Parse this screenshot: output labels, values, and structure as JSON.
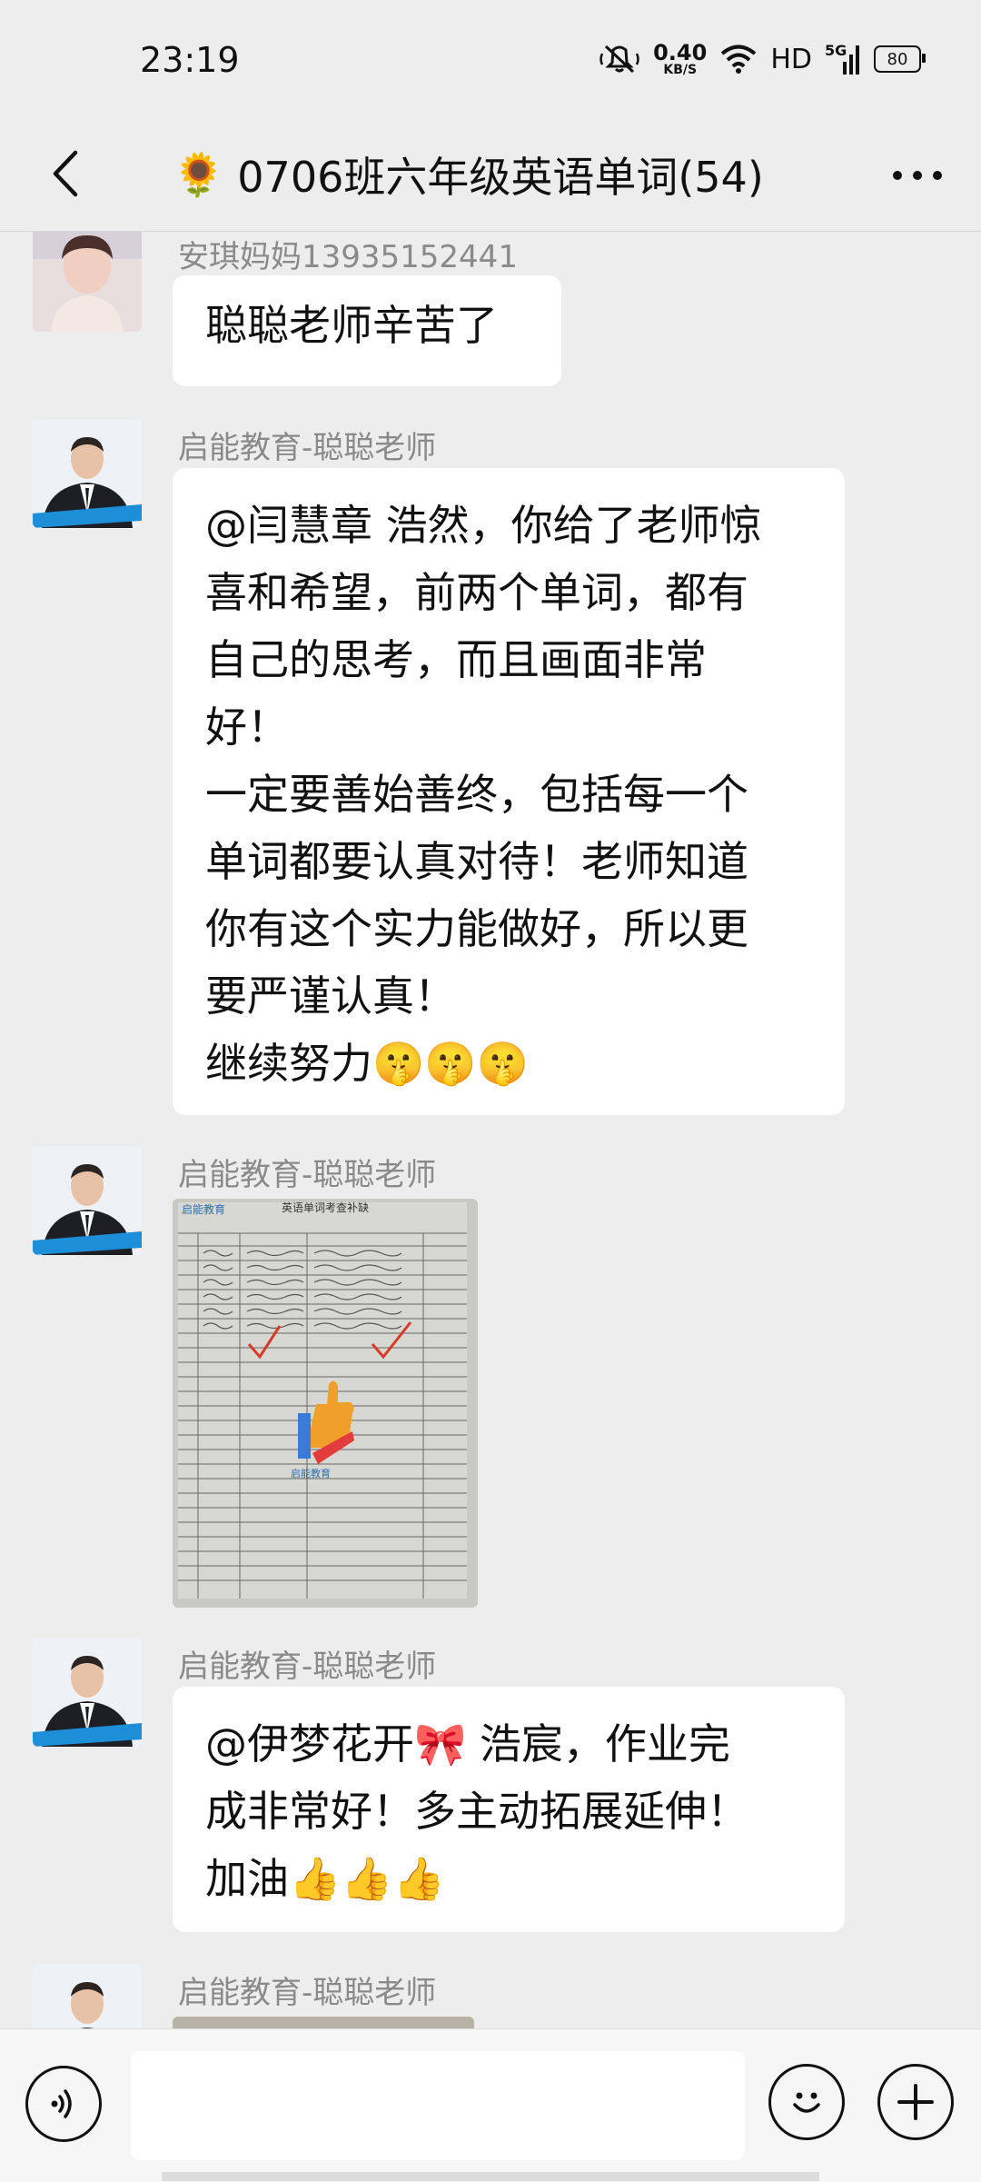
{
  "status_bar": {
    "time": "23:19",
    "speed_value": "0.40",
    "speed_unit": "KB/S",
    "network": "HD",
    "signal_label": "5G",
    "battery": "80",
    "icons": [
      "mute-bell-icon",
      "wifi-icon",
      "signal-icon",
      "battery-icon"
    ]
  },
  "nav": {
    "title_emoji": "🌻",
    "title": "0706班六年级英语单词(54)",
    "back_icon": "chevron-left-icon",
    "more_icon": "more-dots-icon"
  },
  "messages": [
    {
      "sender": "安琪妈妈13935152441",
      "type": "text",
      "lines": [
        "聪聪老师辛苦了"
      ]
    },
    {
      "sender": "启能教育-聪聪老师",
      "type": "text",
      "lines": [
        "@闫慧章  浩然，你给了老师惊",
        "喜和希望，前两个单词，都有",
        "自己的思考，而且画面非常",
        "好！",
        "一定要善始善终，包括每一个",
        "单词都要认真对待！老师知道",
        "你有这个实力能做好，所以更",
        "要严谨认真！",
        "继续努力🤫🤫🤫"
      ]
    },
    {
      "sender": "启能教育-聪聪老师",
      "type": "image",
      "image_title": "英语单词考查补缺",
      "image_brand": "启能教育"
    },
    {
      "sender": "启能教育-聪聪老师",
      "type": "text",
      "lines": [
        "@伊梦花开🎀  浩宸，作业完",
        "成非常好！多主动拓展延伸！",
        "加油👍👍👍"
      ]
    },
    {
      "sender": "启能教育-聪聪老师",
      "type": "image"
    }
  ],
  "input_bar": {
    "placeholder": "",
    "voice_icon": "voice-icon",
    "emoji_icon": "emoji-smile-icon",
    "plus_icon": "plus-icon"
  }
}
